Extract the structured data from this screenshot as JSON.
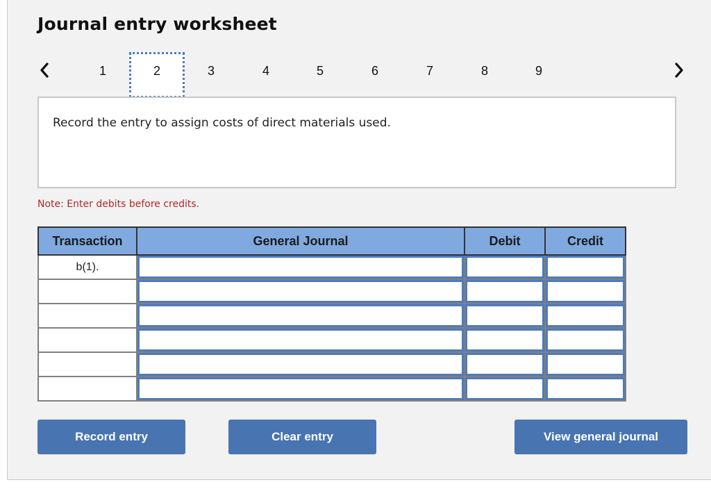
{
  "worksheet": {
    "title": "Journal entry worksheet",
    "pager": {
      "prev_icon": "chevron-left-icon",
      "next_icon": "chevron-right-icon",
      "pages": [
        "1",
        "2",
        "3",
        "4",
        "5",
        "6",
        "7",
        "8",
        "9"
      ],
      "active_page": "2"
    },
    "prompt": "Record the entry to assign costs of direct materials used.",
    "note": "Note: Enter debits before credits.",
    "colors": {
      "header_bg": "#80a9df",
      "button_bg": "#4874b2",
      "note_text": "#b0282a",
      "input_border": "#4f7bba"
    }
  },
  "journal": {
    "columns": [
      "Transaction",
      "General Journal",
      "Debit",
      "Credit"
    ],
    "rows": [
      {
        "transaction": "b(1).",
        "account": "",
        "debit": "",
        "credit": ""
      },
      {
        "transaction": "",
        "account": "",
        "debit": "",
        "credit": ""
      },
      {
        "transaction": "",
        "account": "",
        "debit": "",
        "credit": ""
      },
      {
        "transaction": "",
        "account": "",
        "debit": "",
        "credit": ""
      },
      {
        "transaction": "",
        "account": "",
        "debit": "",
        "credit": ""
      },
      {
        "transaction": "",
        "account": "",
        "debit": "",
        "credit": ""
      }
    ]
  },
  "buttons": {
    "record": "Record entry",
    "clear": "Clear entry",
    "view": "View general journal"
  }
}
